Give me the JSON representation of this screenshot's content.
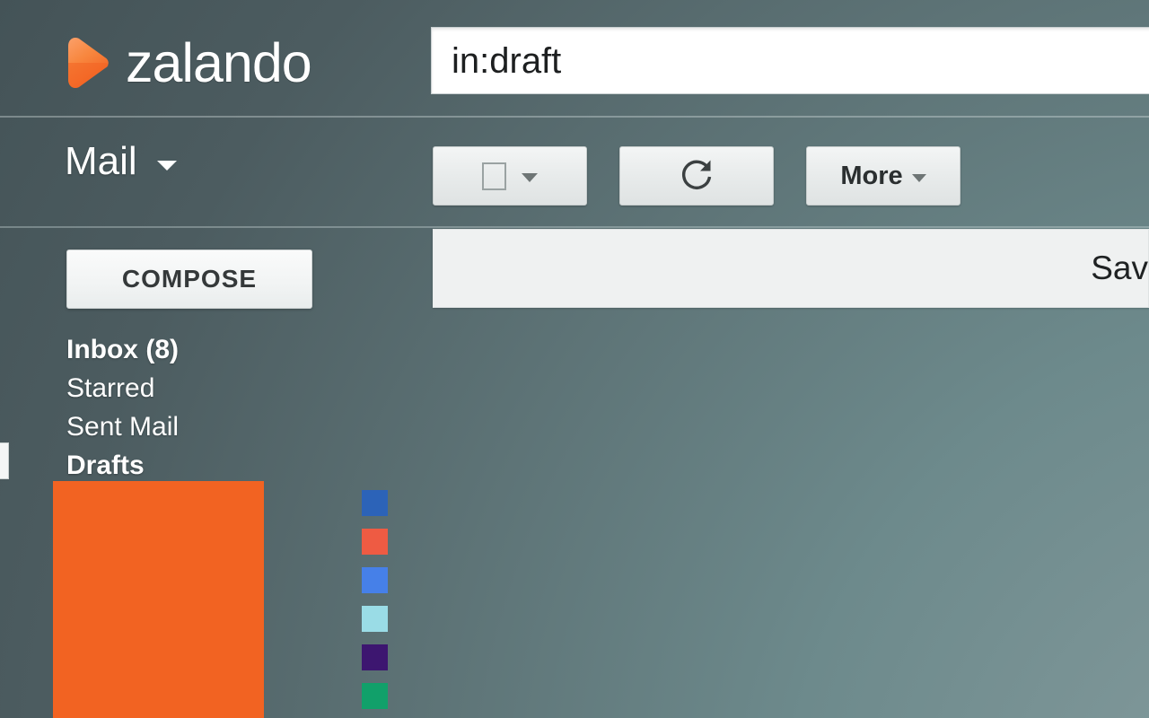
{
  "brand": {
    "name": "zalando",
    "logo_icon": "zalando-play-mark",
    "logo_color": "#f26322"
  },
  "search": {
    "value": "in:draft",
    "placeholder": ""
  },
  "appbar": {
    "app_label": "Mail",
    "app_caret_icon": "chevron-down-icon"
  },
  "toolbar": {
    "select_all": {
      "icon": "checkbox-icon",
      "caret_icon": "chevron-down-icon"
    },
    "refresh": {
      "icon": "refresh-icon"
    },
    "more": {
      "label": "More",
      "caret_icon": "chevron-down-icon"
    }
  },
  "sidebar": {
    "compose_label": "COMPOSE",
    "items": [
      {
        "label": "Inbox (8)",
        "bold": true
      },
      {
        "label": "Starred",
        "bold": false
      },
      {
        "label": "Sent Mail",
        "bold": false
      },
      {
        "label": "Drafts",
        "bold": true
      }
    ]
  },
  "panel": {
    "action_label": "Sav"
  },
  "swatches": [
    {
      "name": "swatch-indigo-blue",
      "color": "#2c63b8"
    },
    {
      "name": "swatch-coral-red",
      "color": "#ee5b43"
    },
    {
      "name": "swatch-royal-blue",
      "color": "#4680e8"
    },
    {
      "name": "swatch-light-cyan",
      "color": "#9adce6"
    },
    {
      "name": "swatch-deep-purple",
      "color": "#3d1670"
    },
    {
      "name": "swatch-emerald-green",
      "color": "#11a06a"
    }
  ],
  "theme": {
    "background_dark": "#445357",
    "background_light": "#7b9496",
    "accent_orange": "#f26322",
    "panel_bg": "#eff1f1"
  }
}
